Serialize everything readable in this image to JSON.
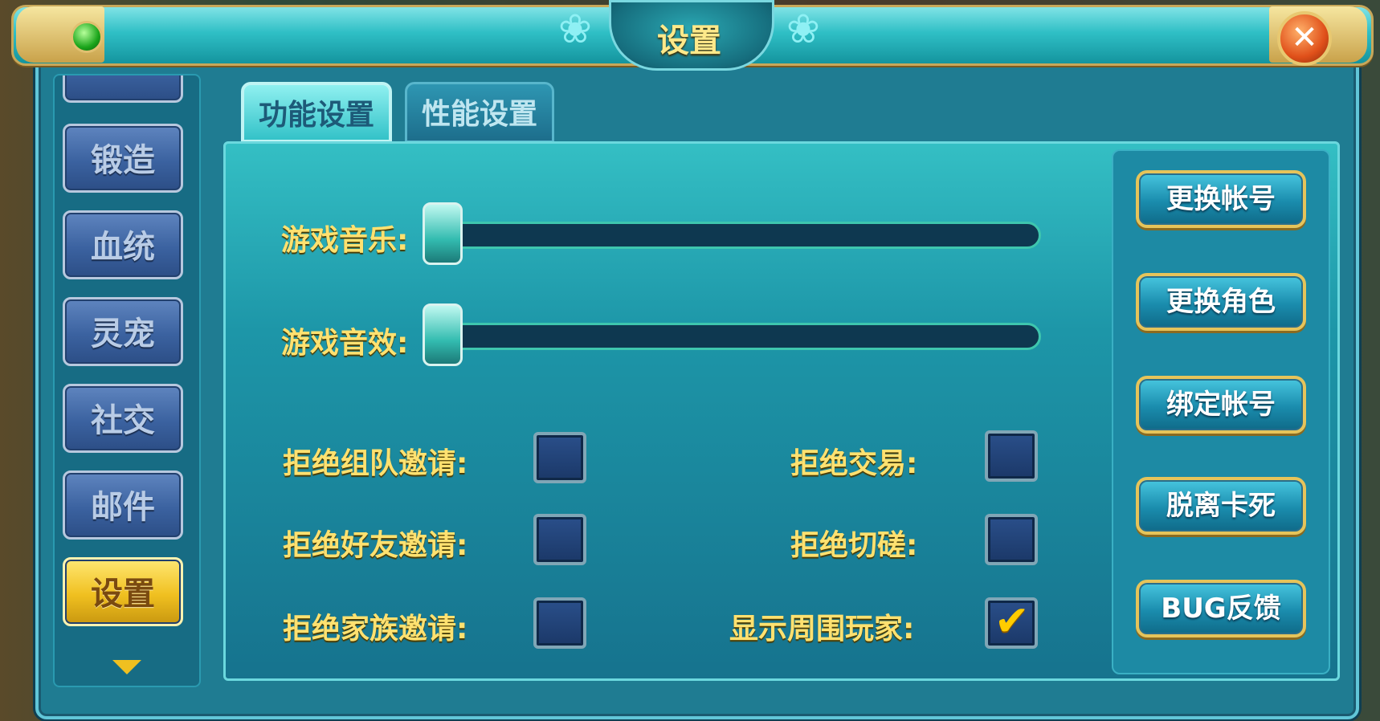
{
  "window": {
    "title": "设置",
    "close_icon": "close-x-icon",
    "gem_icon": "green-gem-icon"
  },
  "left_nav": {
    "items": [
      {
        "label": "锻造",
        "active": false
      },
      {
        "label": "血统",
        "active": false
      },
      {
        "label": "灵宠",
        "active": false
      },
      {
        "label": "社交",
        "active": false
      },
      {
        "label": "邮件",
        "active": false
      },
      {
        "label": "设置",
        "active": true
      }
    ],
    "scroll_down_icon": "chevron-down-icon"
  },
  "tabs": [
    {
      "label": "功能设置",
      "active": true
    },
    {
      "label": "性能设置",
      "active": false
    }
  ],
  "sliders": [
    {
      "label": "游戏音乐:",
      "value": 0
    },
    {
      "label": "游戏音效:",
      "value": 0
    }
  ],
  "options": {
    "left": [
      {
        "label": "拒绝组队邀请:",
        "checked": false
      },
      {
        "label": "拒绝好友邀请:",
        "checked": false
      },
      {
        "label": "拒绝家族邀请:",
        "checked": false
      }
    ],
    "right": [
      {
        "label": "拒绝交易:",
        "checked": false
      },
      {
        "label": "拒绝切磋:",
        "checked": false
      },
      {
        "label": "显示周围玩家:",
        "checked": true
      }
    ]
  },
  "actions": [
    {
      "label": "更换帐号"
    },
    {
      "label": "更换角色"
    },
    {
      "label": "绑定帐号"
    },
    {
      "label": "脱离卡死"
    },
    {
      "label": "BUG反馈"
    }
  ],
  "colors": {
    "accent_gold": "#ffe170",
    "panel_teal": "#1d96a8",
    "active_nav": "#f0c020"
  }
}
